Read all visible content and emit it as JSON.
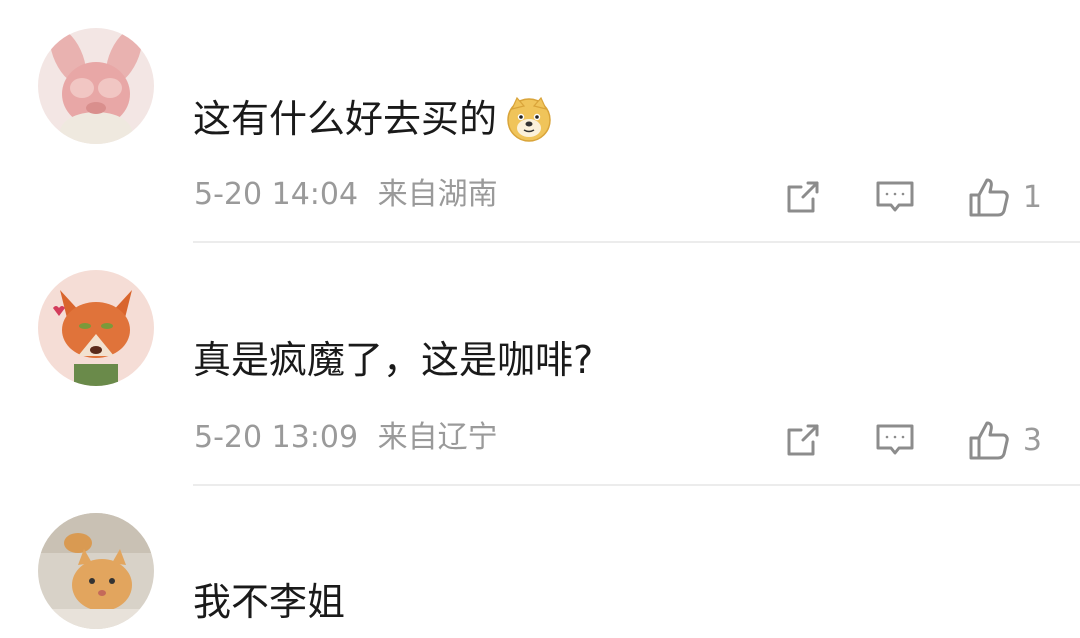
{
  "comments": [
    {
      "text": "这有什么好去买的",
      "time": "5-20 14:04",
      "location": "来自湖南",
      "likes": "1",
      "emoji": "doge-emoji"
    },
    {
      "text": "真是疯魔了，这是咖啡?",
      "time": "5-20 13:09",
      "location": "来自辽宁",
      "likes": "3"
    },
    {
      "text": "我不李姐"
    }
  ],
  "colors": {
    "meta_text": "#9a9a9a",
    "icon_stroke": "#8c8c8c",
    "divider": "#ececec"
  },
  "icons": [
    "share-icon",
    "comment-icon",
    "like-icon"
  ]
}
